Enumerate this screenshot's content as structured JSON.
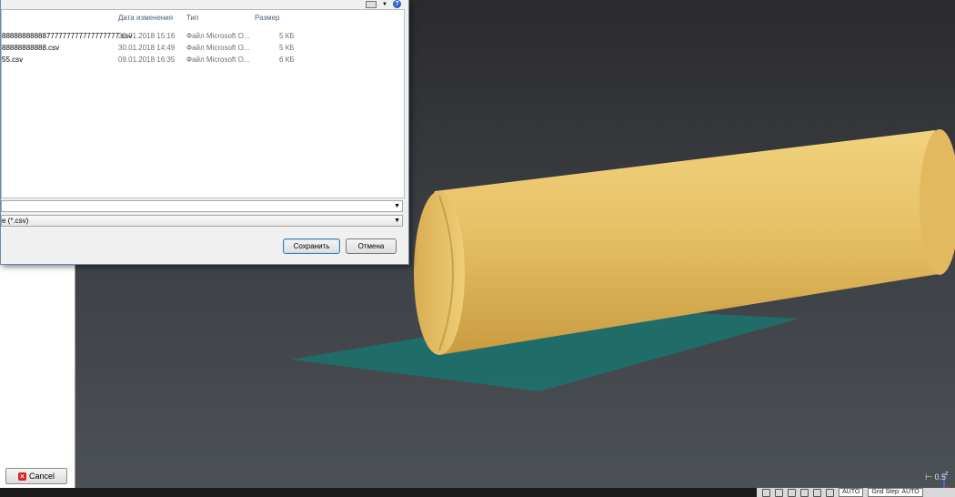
{
  "dialog": {
    "columns": {
      "date": "Дата изменения",
      "type": "Тип",
      "size": "Размер"
    },
    "files": [
      {
        "name": "88888888888777777777777777777.csv",
        "date": "30.01.2018 15:16",
        "type": "Файл Microsoft O...",
        "size": "5 КБ"
      },
      {
        "name": "88888888888.csv",
        "date": "30.01.2018 14:49",
        "type": "Файл Microsoft O...",
        "size": "5 КБ"
      },
      {
        "name": "55.csv",
        "date": "09.01.2018 16:35",
        "type": "Файл Microsoft O...",
        "size": "6 КБ"
      }
    ],
    "filename_value": "",
    "filetype_value": "e (*.csv)",
    "save_label": "Сохранить",
    "cancel_label": "Отмена"
  },
  "left_panel": {
    "cancel_label": "Cancel"
  },
  "viewport": {
    "scale_label": "0.5",
    "axis_label": "z",
    "colors": {
      "cylinder": "#e9c36a",
      "plane": "#1f6f6a"
    }
  },
  "statusbar": {
    "mode": "AUTO",
    "grid_label": "Grid Step: AUTO"
  }
}
